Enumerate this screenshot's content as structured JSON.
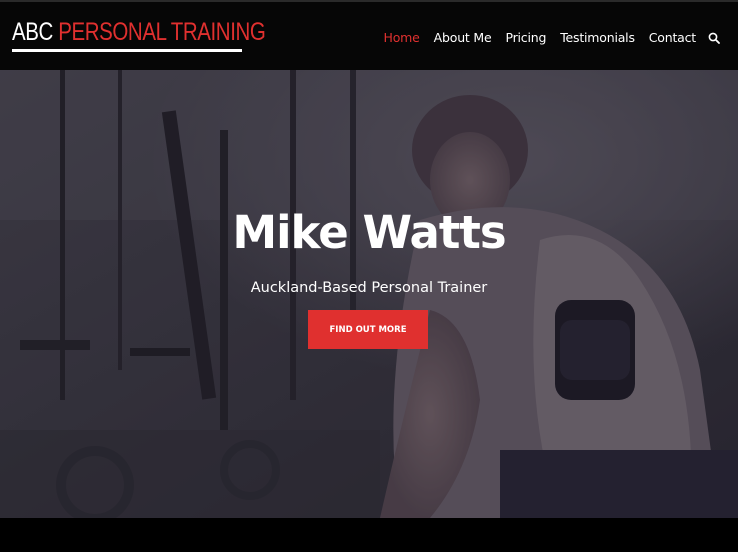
{
  "header": {
    "logo_part1": "ABC",
    "logo_part2": "PERSONAL TRAINING",
    "nav": [
      "Home",
      "About Me",
      "Pricing",
      "Testimonials",
      "Contact"
    ],
    "active_nav": "Home",
    "search_icon": "search-icon"
  },
  "hero": {
    "title": "Mike Watts",
    "subtitle": "Auckland-Based Personal Trainer",
    "cta_label": "FIND OUT MORE",
    "background": "gym-trainer-photo"
  },
  "colors": {
    "accent": "#e0302f",
    "header_bg": "#060606",
    "text": "#ffffff"
  }
}
